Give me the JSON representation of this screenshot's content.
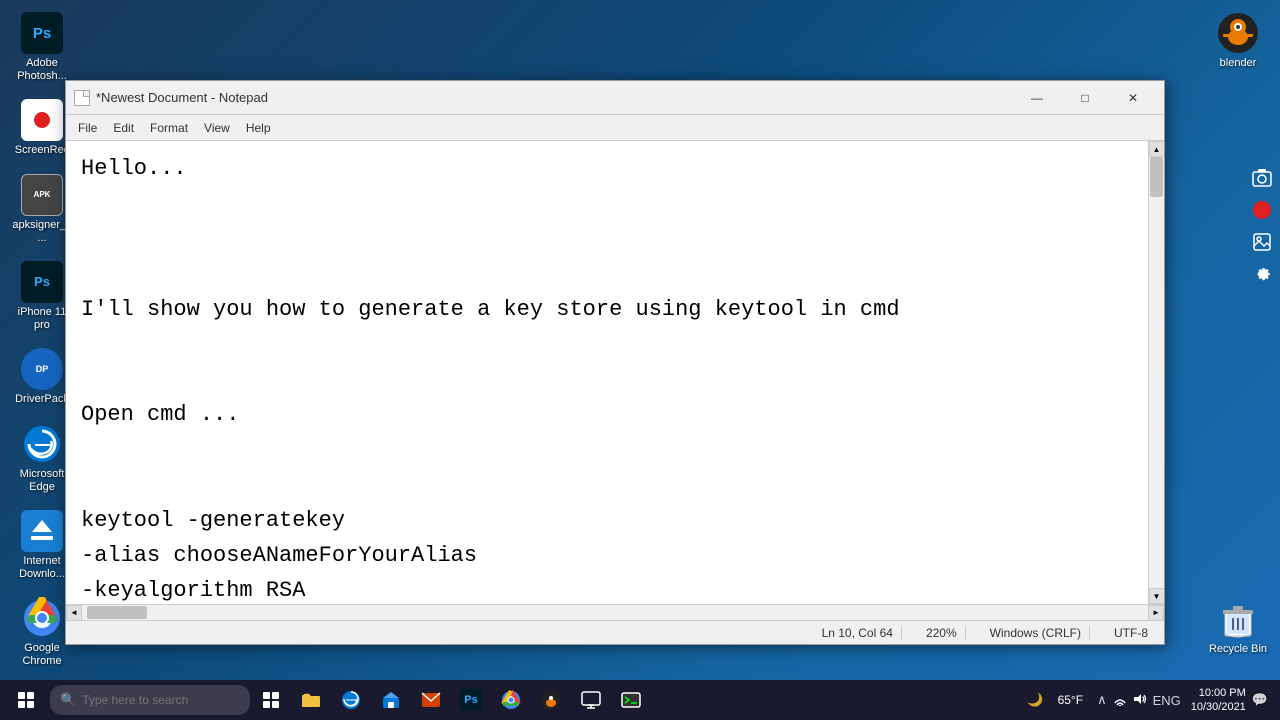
{
  "desktop": {
    "icons_left": [
      {
        "id": "adobe-photoshop",
        "label": "Adobe\nPhotosh...",
        "type": "ps"
      },
      {
        "id": "screenrec",
        "label": "ScreenRec",
        "type": "screenrec"
      },
      {
        "id": "apksigner",
        "label": "apksigner_v...",
        "type": "generic",
        "color": "#555"
      },
      {
        "id": "psd-iphone",
        "label": "iPhone 11\npro",
        "type": "psd"
      },
      {
        "id": "driverpack",
        "label": "DriverPack",
        "type": "generic",
        "color": "#1565C0"
      },
      {
        "id": "microsoft-edge",
        "label": "Microsoft\nEdge",
        "type": "edge"
      },
      {
        "id": "internet-download",
        "label": "Internet\nDownlo...",
        "type": "generic",
        "color": "#1a7fd4"
      },
      {
        "id": "google-chrome",
        "label": "Google\nChrome",
        "type": "chrome"
      }
    ],
    "icons_right": [
      {
        "id": "blender",
        "label": "blender",
        "type": "blender"
      }
    ],
    "recycle_bin": {
      "label": "Recycle Bin",
      "type": "recyclebin"
    }
  },
  "notepad": {
    "title": "*Newest Document - Notepad",
    "doc_icon": "📄",
    "menu_items": [
      "File",
      "Edit",
      "Format",
      "View",
      "Help"
    ],
    "content": "Hello...\n\n\nI'll show you how to generate a key store using keytool in cmd\n\n\nOpen cmd ...\n\n\nkeytool -generatekey\n-alias chooseANameForYourAlias\n-keyalgorithm RSA\nkeystore path \"\" ===> wher you want save the key store.jks ...",
    "status": {
      "ln_col": "Ln 10, Col 64",
      "zoom": "220%",
      "line_ending": "Windows (CRLF)",
      "encoding": "UTF-8"
    },
    "controls": {
      "minimize": "—",
      "maximize": "□",
      "close": "✕"
    }
  },
  "taskbar": {
    "search_placeholder": "Type here to search",
    "apps": [],
    "weather": "65°F",
    "time": "10:00 PM",
    "date": "10/30/2021",
    "language": "ENG"
  }
}
